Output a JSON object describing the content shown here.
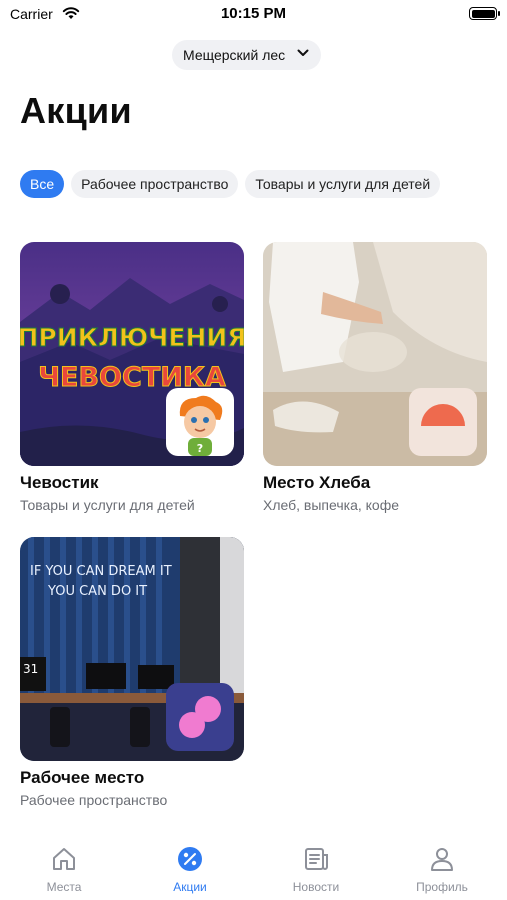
{
  "status_bar": {
    "carrier": "Carrier",
    "time": "10:15 PM"
  },
  "location": {
    "label": "Мещерский лес"
  },
  "page_title": "Акции",
  "filters": [
    {
      "label": "Все",
      "active": true
    },
    {
      "label": "Рабочее пространство",
      "active": false
    },
    {
      "label": "Товары и услуги для детей",
      "active": false
    }
  ],
  "cards": [
    {
      "title": "Чевостик",
      "subtitle": "Товары и услуги для детей",
      "image_text_line1": "ПРИКЛЮЧЕНИЯ",
      "image_text_line2": "ЧЕВОСТИКА",
      "badge_char": "?"
    },
    {
      "title": "Место Хлеба",
      "subtitle": "Хлеб, выпечка, кофе"
    },
    {
      "title": "Рабочее место",
      "subtitle": "Рабочее пространство",
      "neon_line1": "IF YOU CAN DREAM IT",
      "neon_line2": "YOU CAN DO IT",
      "calendar_day": "31"
    }
  ],
  "tabs": [
    {
      "label": "Места",
      "icon": "home-icon",
      "active": false
    },
    {
      "label": "Акции",
      "icon": "percent-icon",
      "active": true
    },
    {
      "label": "Новости",
      "icon": "news-icon",
      "active": false
    },
    {
      "label": "Профиль",
      "icon": "profile-icon",
      "active": false
    }
  ],
  "colors": {
    "accent": "#2f7bf1",
    "inactive": "#8d9099",
    "chip_bg": "#f0f1f4"
  }
}
